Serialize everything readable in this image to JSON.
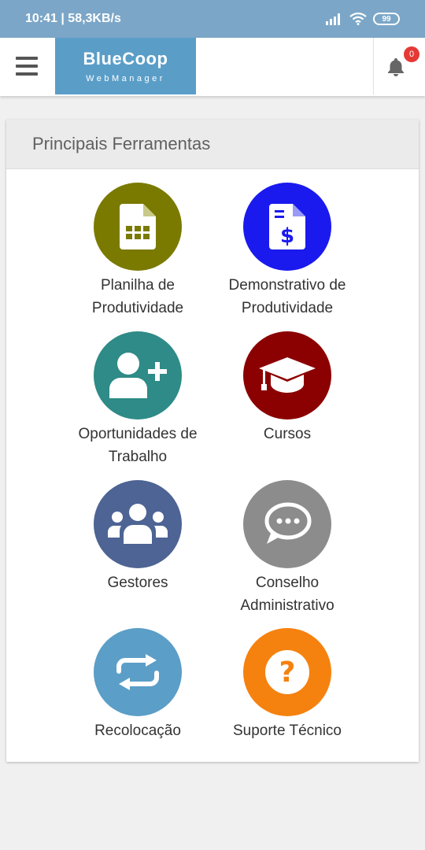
{
  "status_bar": {
    "time_speed": "10:41 | 58,3KB/s",
    "battery": "99"
  },
  "header": {
    "brand_title": "BlueCoop",
    "brand_subtitle": "WebManager",
    "notification_count": "0"
  },
  "card": {
    "title": "Principais Ferramentas",
    "tools": [
      {
        "line1": "Planilha de",
        "line2": "Produtividade",
        "color": "#7a7a00",
        "icon": "spreadsheet-icon"
      },
      {
        "line1": "Demonstrativo de",
        "line2": "Produtividade",
        "color": "#1a1aef",
        "icon": "invoice-dollar-icon"
      },
      {
        "line1": "Oportunidades de",
        "line2": "Trabalho",
        "color": "#2e8b87",
        "icon": "user-plus-icon"
      },
      {
        "line1": "Cursos",
        "line2": "",
        "color": "#8b0000",
        "icon": "graduation-cap-icon"
      },
      {
        "line1": "Gestores",
        "line2": "",
        "color": "#4d6494",
        "icon": "users-group-icon"
      },
      {
        "line1": "Conselho",
        "line2": "Administrativo",
        "color": "#8c8c8c",
        "icon": "chat-bubble-icon"
      },
      {
        "line1": "Recolocação",
        "line2": "",
        "color": "#5b9ec7",
        "icon": "repeat-icon"
      },
      {
        "line1": "Suporte Técnico",
        "line2": "",
        "color": "#f5820f",
        "icon": "question-icon"
      }
    ]
  }
}
